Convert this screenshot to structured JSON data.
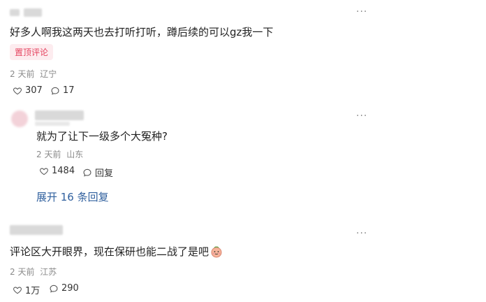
{
  "comments": [
    {
      "text": "好多人啊我这两天也去打听打听，蹲后续的可以gz我一下",
      "badge": "置顶评论",
      "time": "2 天前",
      "location": "辽宁",
      "likes": "307",
      "replies": "17"
    },
    {
      "text": "就为了让下一级多个大冤种?",
      "time": "2 天前",
      "location": "山东",
      "likes": "1484",
      "reply_label": "回复",
      "expand_label": "展开 16 条回复"
    },
    {
      "text": "评论区大开眼界，现在保研也能二战了是吧",
      "time": "2 天前",
      "location": "江苏",
      "likes": "1万",
      "replies": "290"
    }
  ],
  "more_glyph": "···",
  "icons": [
    "heart-icon",
    "comment-icon",
    "avatar-blurred",
    "blushing-emoji-icon"
  ],
  "colors": {
    "badge_text": "#e5435f",
    "badge_bg": "#fdecef",
    "link": "#30609e"
  }
}
